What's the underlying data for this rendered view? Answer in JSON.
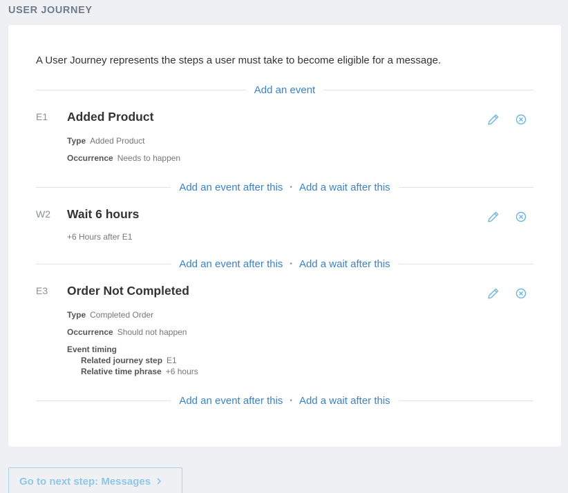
{
  "page": {
    "title": "USER JOURNEY"
  },
  "intro": "A User Journey represents the steps a user must take to become eligible for a message.",
  "add_event_label": "Add an event",
  "add_event_after_label": "Add an event after this",
  "add_wait_after_label": "Add a wait after this",
  "separator": "•",
  "steps": [
    {
      "id": "E1",
      "title": "Added Product",
      "type_label": "Type",
      "type_value": "Added Product",
      "occurrence_label": "Occurrence",
      "occurrence_value": "Needs to happen"
    },
    {
      "id": "W2",
      "title": "Wait 6 hours",
      "description": "+6 Hours after E1"
    },
    {
      "id": "E3",
      "title": "Order Not Completed",
      "type_label": "Type",
      "type_value": "Completed Order",
      "occurrence_label": "Occurrence",
      "occurrence_value": "Should not happen",
      "timing_label": "Event timing",
      "related_label": "Related journey step",
      "related_value": "E1",
      "relative_label": "Relative time phrase",
      "relative_value": "+6 hours"
    }
  ],
  "next_button": {
    "label": "Go to next step: Messages",
    "icon": "chevron-right-icon"
  },
  "colors": {
    "link": "#3b82c4",
    "icon": "#6ab4dd",
    "button": "#8fc7e6",
    "background": "#eef0f4"
  }
}
